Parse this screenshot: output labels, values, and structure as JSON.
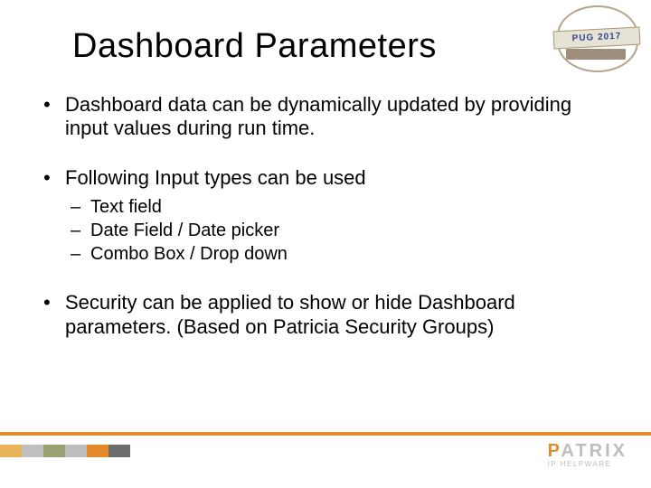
{
  "title": "Dashboard Parameters",
  "bullets": {
    "b1": "Dashboard data can be dynamically updated by providing input values during run time.",
    "b2": "Following Input types can be used",
    "b2_sub": {
      "s1": "Text field",
      "s2": "Date Field / Date picker",
      "s3": "Combo Box / Drop down"
    },
    "b3": "Security can be applied to show or hide Dashboard parameters. (Based on Patricia Security Groups)"
  },
  "badge": {
    "text": "PUG 2017"
  },
  "footer": {
    "brand_rest": "ATRIX",
    "brand_initial": "P",
    "tagline": "IP HELPWARE"
  },
  "colors": {
    "accent": "#e58a2a"
  }
}
